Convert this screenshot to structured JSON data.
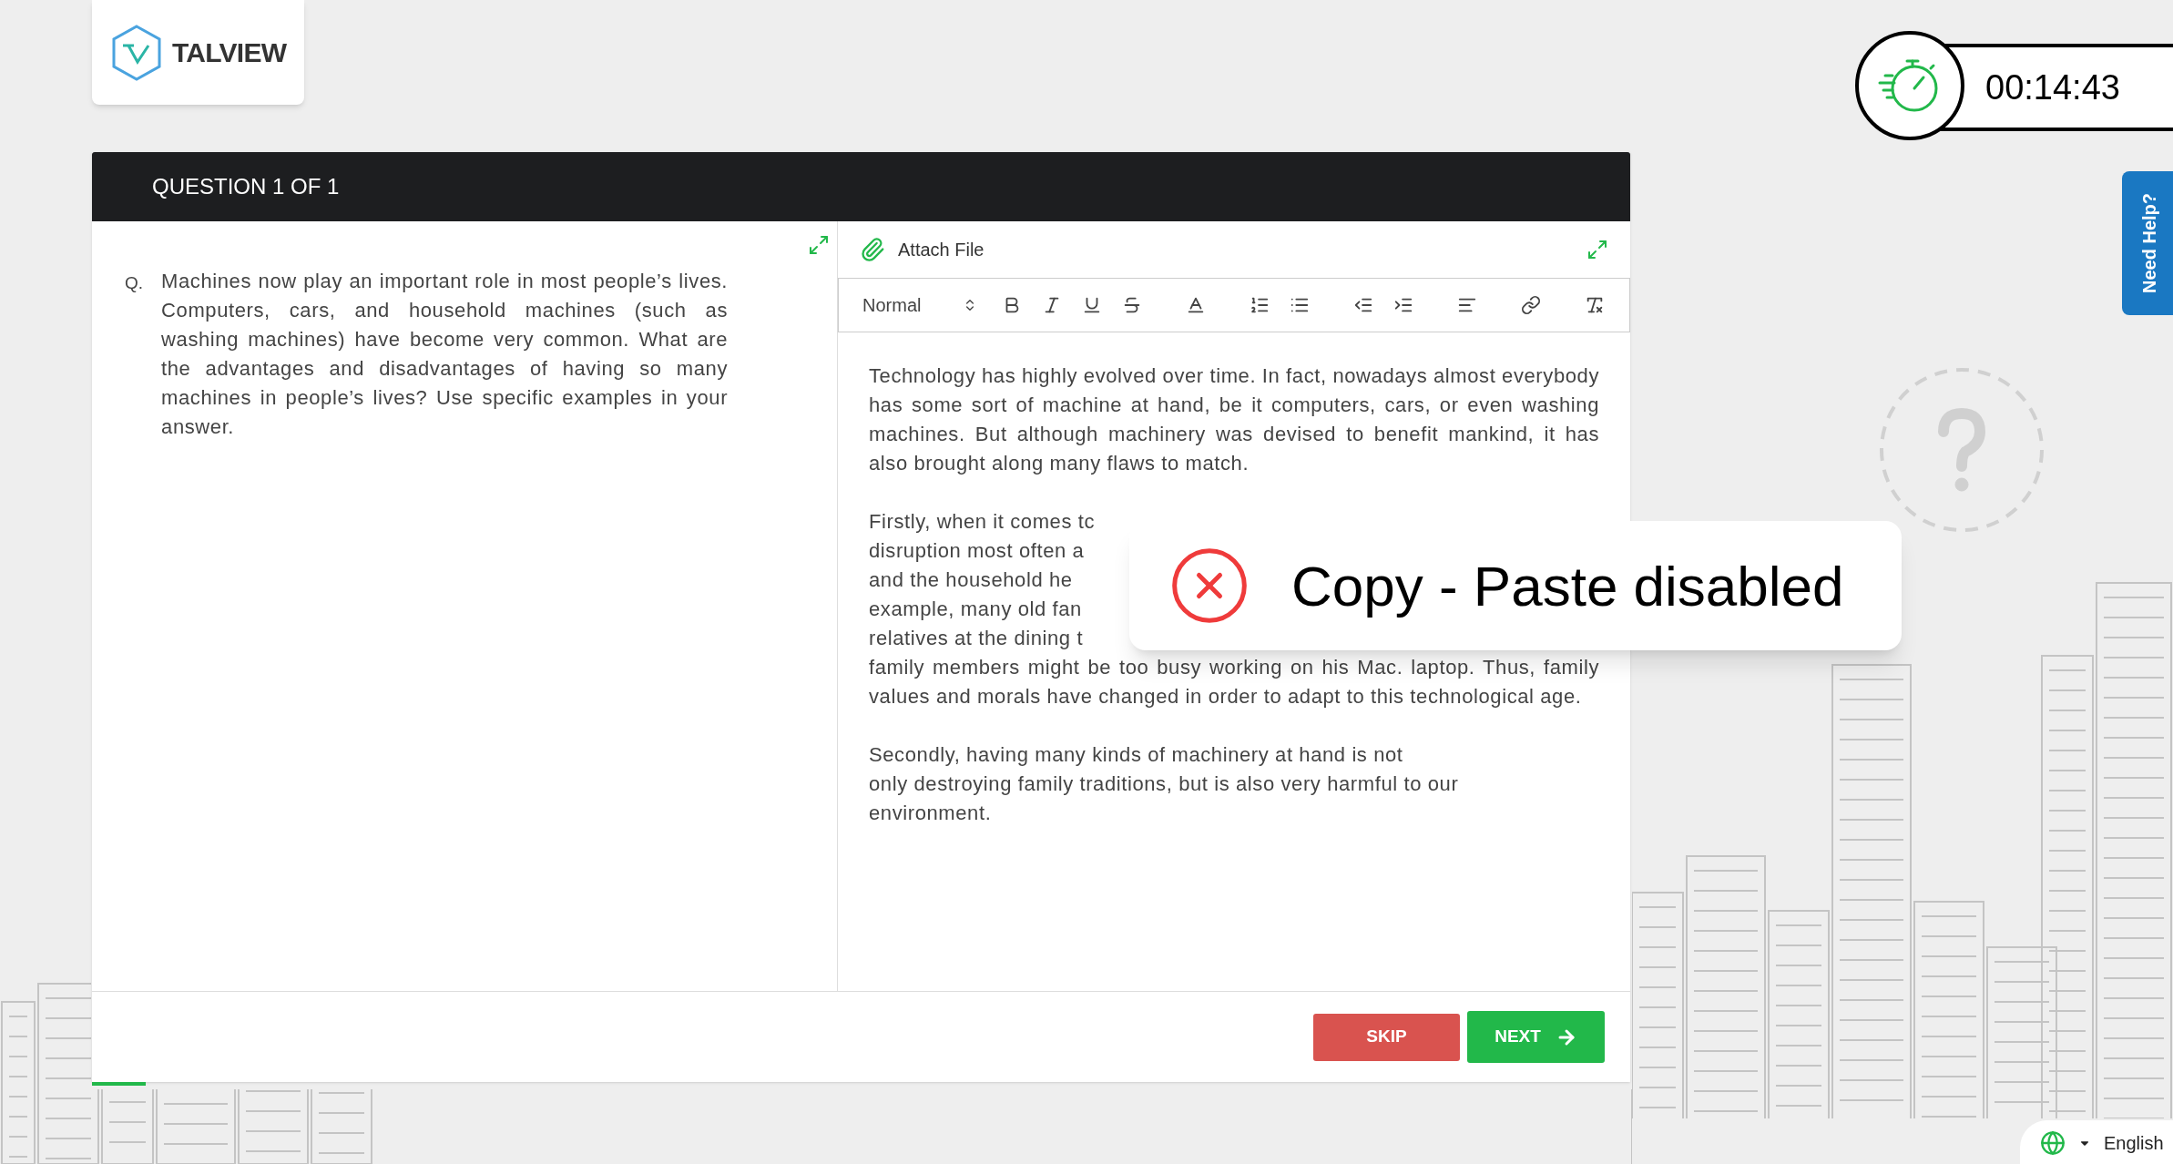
{
  "logo": {
    "text": "TALVIEW"
  },
  "timer": {
    "time": "00:14:43"
  },
  "help_tab": {
    "label": "Need Help?"
  },
  "question": {
    "header": "QUESTION 1 OF 1",
    "prefix": "Q.",
    "text": "Machines now play an important role in most people’s lives. Computers, cars, and household machines (such as washing machines) have become very common. What are the advantages and disadvantages of having so many machines in people’s lives? Use specific examples in your answer."
  },
  "answer": {
    "attach_label": "Attach File",
    "style_select": "Normal",
    "paragraphs": [
      {
        "kind": "full",
        "text": "Technology has highly evolved over time. In fact, nowadays almost everybody has some sort of machine at hand, be it computers, cars, or even washing machines. But although machinery was devised to benefit mankind, it has also brought along many flaws to match."
      },
      {
        "kind": "covered",
        "lines": [
          "Firstly, when it comes tc",
          "disruption most often a",
          "and the household he",
          "example, many old fan",
          "relatives at the dining t"
        ],
        "text": "family members might be too busy working on his Mac. laptop. Thus, family values and morals have changed in order to adapt to this technological age."
      },
      {
        "kind": "lines",
        "lines": [
          "Secondly, having many kinds of machinery at hand is not",
          "only destroying family traditions, but is also very harmful to our",
          "environment."
        ]
      }
    ]
  },
  "buttons": [
    {
      "kind": "skip",
      "label": "SKIP"
    },
    {
      "kind": "next",
      "label": "NEXT"
    }
  ],
  "progress": {
    "level": 0.035
  },
  "toast": {
    "message": "Copy - Paste disabled"
  },
  "language": {
    "label": "English"
  }
}
